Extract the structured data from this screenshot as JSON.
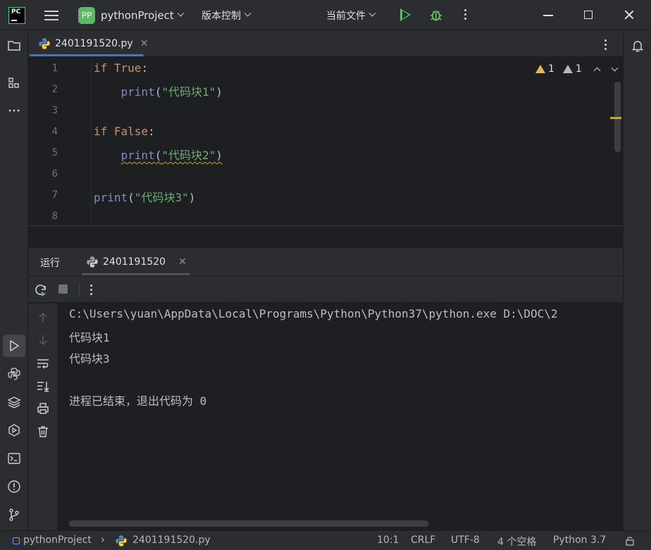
{
  "titlebar": {
    "app_logo_text": "PC",
    "project_badge": "PP",
    "project_name": "pythonProject",
    "vcs_label": "版本控制",
    "run_config": "当前文件",
    "icons": [
      "hamburger-menu-icon",
      "run-icon",
      "debug-icon",
      "more-icon",
      "minimize-icon",
      "maximize-icon",
      "close-icon"
    ]
  },
  "editor_tab": {
    "filename": "2401191520.py"
  },
  "inspections": {
    "warnings": "1",
    "weak_warnings": "1"
  },
  "editor": {
    "line_numbers": [
      "1",
      "2",
      "3",
      "4",
      "5",
      "6",
      "7",
      "8"
    ]
  },
  "code": {
    "l1_kw": "if",
    "l1_const": "True",
    "l1_colon": ":",
    "l2_fn": "print",
    "l2_open": "(",
    "l2_str": "\"代码块1\"",
    "l2_close": ")",
    "l4_kw": "if",
    "l4_const": "False",
    "l4_colon": ":",
    "l5_fn": "print",
    "l5_open": "(",
    "l5_str": "\"代码块2\"",
    "l5_close": ")",
    "l7_fn": "print",
    "l7_open": "(",
    "l7_str": "\"代码块3\"",
    "l7_close": ")"
  },
  "run_window": {
    "title": "运行",
    "tab_label": "2401191520",
    "console_lines": [
      "C:\\Users\\yuan\\AppData\\Local\\Programs\\Python\\Python37\\python.exe D:\\DOC\\2",
      "代码块1",
      "代码块3",
      "",
      "进程已结束，退出代码为 0"
    ]
  },
  "statusbar": {
    "project": "pythonProject",
    "file": "2401191520.py",
    "position": "10:1",
    "line_sep": "CRLF",
    "encoding": "UTF-8",
    "indent": "4 个空格",
    "interpreter": "Python 3.7"
  },
  "colors": {
    "accent": "#3574f0",
    "run_green": "#5fb865",
    "warning": "#e6b450",
    "keyword": "#cf8e6d",
    "string": "#6aab73",
    "builtin": "#8888c6"
  }
}
